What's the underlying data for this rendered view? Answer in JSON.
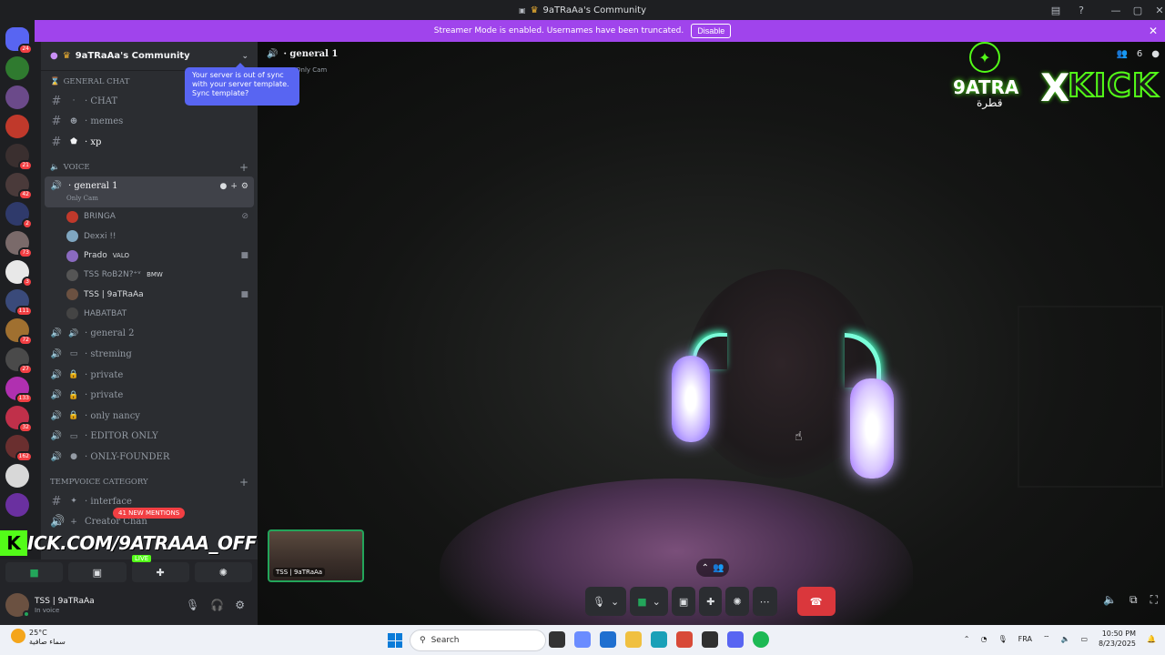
{
  "window": {
    "title": "9aTRaAa's Community",
    "controls": [
      "inbox-icon",
      "help-icon",
      "minimize",
      "maximize",
      "close"
    ]
  },
  "streamer_banner": {
    "text": "Streamer Mode is enabled. Usernames have been truncated.",
    "button": "Disable"
  },
  "servers": [
    {
      "name": "direct-messages",
      "badge": "24",
      "color": "#5865f2"
    },
    {
      "name": "server-zobla",
      "badge": "",
      "color": "#2f7a2f"
    },
    {
      "name": "server-2",
      "badge": "",
      "color": "#6b4a8a"
    },
    {
      "name": "server-palestine",
      "badge": "",
      "color": "#c0392b"
    },
    {
      "name": "server-3",
      "badge": "21",
      "color": "#3a2f2f"
    },
    {
      "name": "server-4",
      "badge": "42",
      "color": "#4a3a3a"
    },
    {
      "name": "server-5",
      "badge": "2",
      "color": "#2f3a6b"
    },
    {
      "name": "server-6",
      "badge": "73",
      "color": "#7a6a6a"
    },
    {
      "name": "server-fam",
      "badge": "3",
      "color": "#e8e8e8"
    },
    {
      "name": "server-7",
      "badge": "111",
      "color": "#3a4a7a"
    },
    {
      "name": "server-8",
      "badge": "72",
      "color": "#a07030"
    },
    {
      "name": "server-9",
      "badge": "27",
      "color": "#4a4a4a"
    },
    {
      "name": "server-10",
      "badge": "133",
      "color": "#b030b0"
    },
    {
      "name": "server-11",
      "badge": "32",
      "color": "#c0304a"
    },
    {
      "name": "server-12",
      "badge": "162",
      "color": "#6a2f2f"
    },
    {
      "name": "server-13",
      "badge": "",
      "color": "#d8d8d8"
    },
    {
      "name": "server-14",
      "badge": "",
      "color": "#6a30a0"
    }
  ],
  "guild": {
    "name": "9aTRaAa's Community",
    "tooltip": "Your server is out of sync with your server template. Sync template?"
  },
  "categories": {
    "general_chat": "GENERAL CHAT",
    "voice": "VOICE",
    "tempvoice": "TEMPVOICE CATEGORY"
  },
  "text_channels": [
    {
      "emoji": "·",
      "name": "· CHAT"
    },
    {
      "emoji": "☻",
      "name": "· memes"
    },
    {
      "emoji": "⬟",
      "name": "· xp"
    }
  ],
  "active_voice": {
    "name": "· general 1",
    "subtitle": "Only Cam"
  },
  "voice_users": [
    {
      "name": "BRINGA",
      "tag": "",
      "color": "#c0392b"
    },
    {
      "name": "Dexxi !!",
      "tag": "",
      "color": "#7fa6c0"
    },
    {
      "name": "Prado",
      "tag": "VALO",
      "color": "#8a6ac0"
    },
    {
      "name": "TSS RoB2N?⁺ᵛ",
      "tag": "BMW",
      "color": "#555"
    },
    {
      "name": "TSS | 9aTRaAa",
      "tag": "",
      "color": "#6b5141"
    },
    {
      "name": "HABATBAT",
      "tag": "",
      "color": "#444"
    }
  ],
  "voice_channels": [
    {
      "emoji": "🔊",
      "name": "· general 2"
    },
    {
      "emoji": "▭",
      "name": "· streming"
    },
    {
      "emoji": "🔒",
      "name": "· private"
    },
    {
      "emoji": "🔒",
      "name": "· private"
    },
    {
      "emoji": "🔒",
      "name": "· only nancy"
    },
    {
      "emoji": "▭",
      "name": "· EDITOR ONLY"
    },
    {
      "emoji": "●",
      "name": "· ONLY-FOUNDER"
    }
  ],
  "temp_channels": [
    {
      "emoji": "✦",
      "name": "· interface"
    },
    {
      "emoji": "+",
      "name": "Creator Chan"
    }
  ],
  "mentions_pill": "41 NEW MENTIONS",
  "overlay": {
    "kick_url": "ICK.COM/9ATRAAA_OFF",
    "live": "LIVE",
    "logo_left": "9ATRA",
    "logo_x": "X",
    "logo_right": "KICK",
    "logo_arabic": "قطرة"
  },
  "user_panel": {
    "name": "TSS | 9aTRaAa",
    "status": "In voice"
  },
  "stage": {
    "channel": "· general 1",
    "subtitle": "Only Cam",
    "members": "6",
    "pip_label": "TSS | 9aTRaAa"
  },
  "taskbar": {
    "temp": "25°C",
    "weather": "سماء صافية",
    "search": "Search",
    "lang": "FRA",
    "time": "10:50 PM",
    "date": "8/23/2025"
  }
}
